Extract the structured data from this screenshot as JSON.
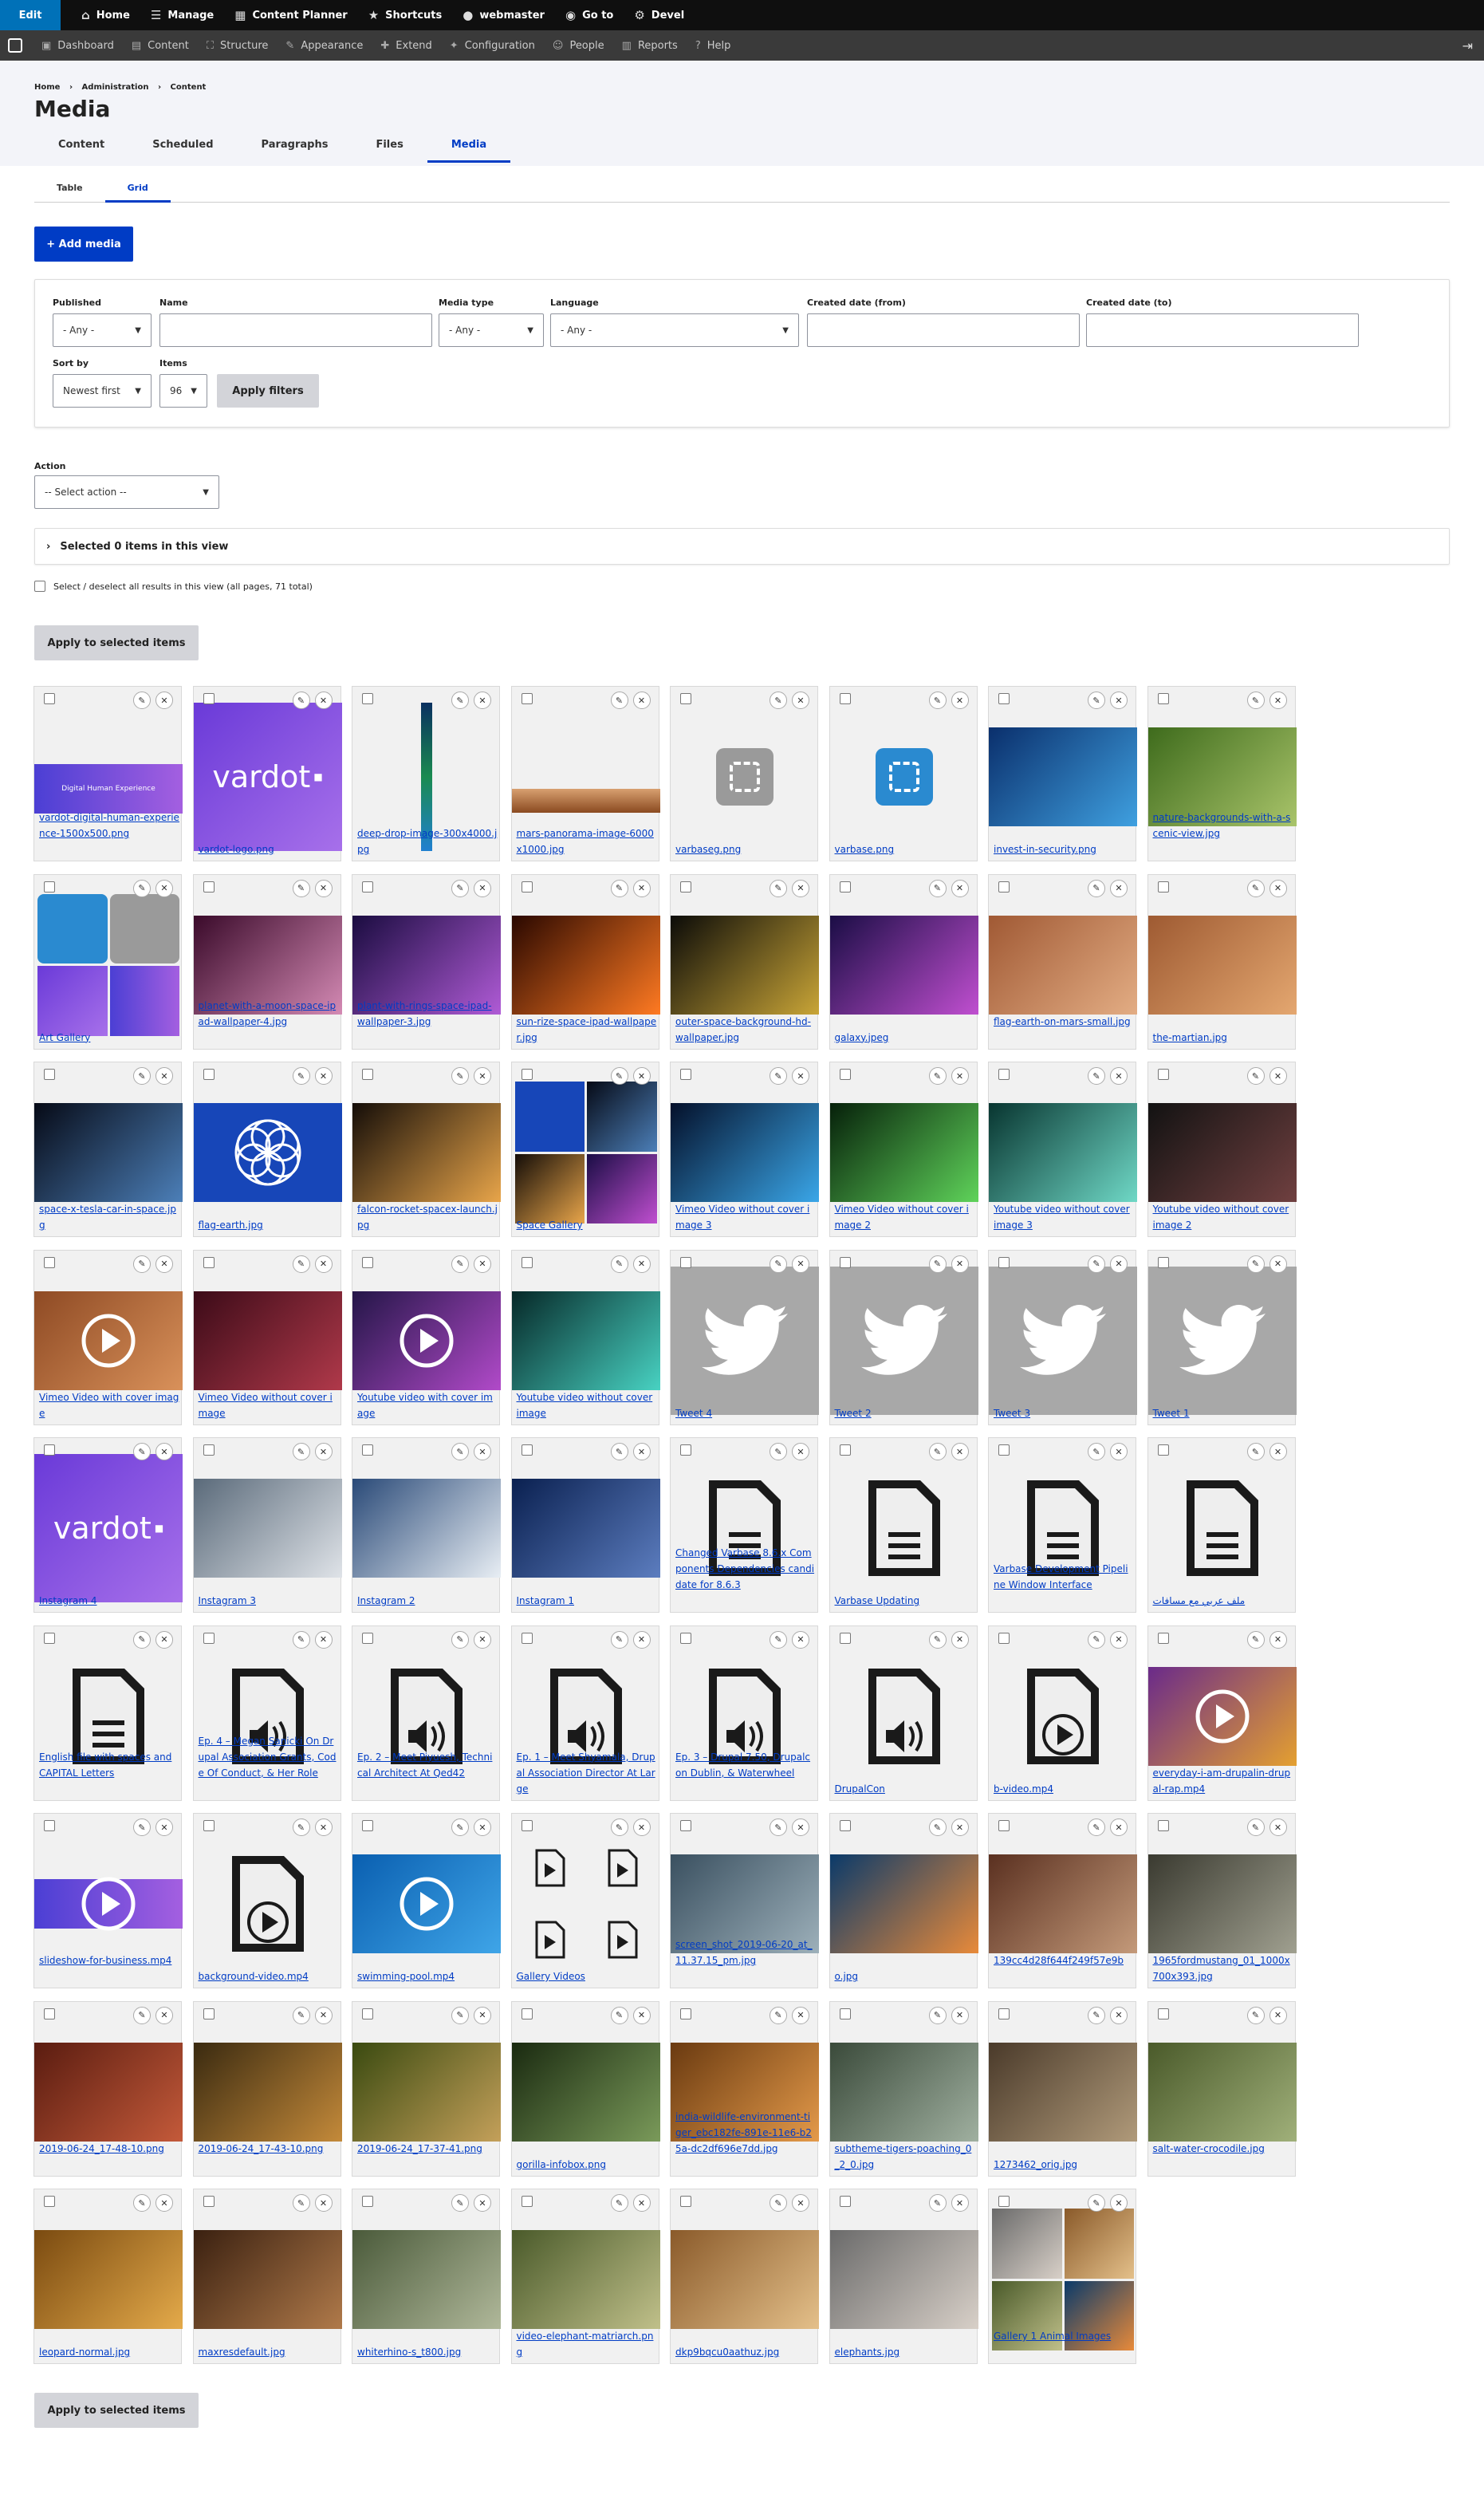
{
  "toolbar": {
    "edit": "Edit",
    "items": [
      {
        "icon": "home-icon",
        "label": "Home"
      },
      {
        "icon": "menu-icon",
        "label": "Manage"
      },
      {
        "icon": "calendar-icon",
        "label": "Content Planner"
      },
      {
        "icon": "star-icon",
        "label": "Shortcuts"
      },
      {
        "icon": "user-icon",
        "label": "webmaster"
      },
      {
        "icon": "goto-icon",
        "label": "Go to"
      },
      {
        "icon": "gear-icon",
        "label": "Devel"
      }
    ]
  },
  "adminmenu": [
    {
      "icon": "dashboard-icon",
      "label": "Dashboard"
    },
    {
      "icon": "content-icon",
      "label": "Content"
    },
    {
      "icon": "structure-icon",
      "label": "Structure"
    },
    {
      "icon": "appearance-icon",
      "label": "Appearance"
    },
    {
      "icon": "extend-icon",
      "label": "Extend"
    },
    {
      "icon": "wrench-icon",
      "label": "Configuration"
    },
    {
      "icon": "people-icon",
      "label": "People"
    },
    {
      "icon": "reports-icon",
      "label": "Reports"
    },
    {
      "icon": "help-icon",
      "label": "Help"
    }
  ],
  "breadcrumb": [
    "Home",
    "Administration",
    "Content"
  ],
  "title": "Media",
  "primary_tabs": [
    "Content",
    "Scheduled",
    "Paragraphs",
    "Files",
    "Media"
  ],
  "secondary_tabs": [
    "Table",
    "Grid"
  ],
  "add_media": "+ Add media",
  "filters": {
    "published_label": "Published",
    "published_value": "- Any -",
    "name_label": "Name",
    "name_value": "",
    "type_label": "Media type",
    "type_value": "- Any -",
    "lang_label": "Language",
    "lang_value": "- Any -",
    "from_label": "Created date (from)",
    "to_label": "Created date (to)",
    "sort_label": "Sort by",
    "sort_value": "Newest first",
    "items_label": "Items",
    "items_value": "96",
    "apply": "Apply filters"
  },
  "action_label": "Action",
  "action_value": "-- Select action --",
  "selected_text": "Selected 0 items in this view",
  "select_all": "Select / deselect all results in this view (all pages, 71 total)",
  "apply_selected": "Apply to selected items",
  "items": [
    {
      "cap": "vardot-digital-human-experience-1500x500.png",
      "kind": "banner"
    },
    {
      "cap": "vardot-logo.png",
      "kind": "vardot"
    },
    {
      "cap": "deep-drop-image-300x4000.jpg",
      "kind": "strip"
    },
    {
      "cap": "mars-panorama-image-6000x1000.jpg",
      "kind": "pano"
    },
    {
      "cap": "varbaseg.png",
      "kind": "grey-logo"
    },
    {
      "cap": "varbase.png",
      "kind": "blue-logo"
    },
    {
      "cap": "invest-in-security.png",
      "kind": "photo",
      "c1": "#0a2f6c",
      "c2": "#3fa0e0"
    },
    {
      "cap": "nature-backgrounds-with-a-scenic-view.jpg",
      "kind": "photo",
      "c1": "#3e6b1c",
      "c2": "#a9c46a"
    },
    {
      "cap": "Art Gallery",
      "kind": "gallery-art"
    },
    {
      "cap": "planet-with-a-moon-space-ipad-wallpaper-4.jpg",
      "kind": "photo",
      "c1": "#3a0a2a",
      "c2": "#d48ab4"
    },
    {
      "cap": "plant-with-rings-space-ipad-wallpaper-3.jpg",
      "kind": "photo",
      "c1": "#1a0c40",
      "c2": "#b05bd6"
    },
    {
      "cap": "sun-rize-space-ipad-wallpaper.jpg",
      "kind": "photo",
      "c1": "#2a0800",
      "c2": "#ff7a22"
    },
    {
      "cap": "outer-space-background-hd-wallpaper.jpg",
      "kind": "photo",
      "c1": "#0b0b08",
      "c2": "#c9a537"
    },
    {
      "cap": "galaxy.jpeg",
      "kind": "photo",
      "c1": "#1a0d45",
      "c2": "#c04fd0"
    },
    {
      "cap": "flag-earth-on-mars-small.jpg",
      "kind": "photo",
      "c1": "#a05934",
      "c2": "#e3ad84"
    },
    {
      "cap": "the-martian.jpg",
      "kind": "photo",
      "c1": "#9e5a32",
      "c2": "#e4a770"
    },
    {
      "cap": "space-x-tesla-car-in-space.jpg",
      "kind": "photo",
      "c1": "#060a16",
      "c2": "#4c7fb8"
    },
    {
      "cap": "flag-earth.jpg",
      "kind": "flag"
    },
    {
      "cap": "falcon-rocket-spacex-launch.jpg",
      "kind": "photo",
      "c1": "#140d08",
      "c2": "#e8a54a"
    },
    {
      "cap": "Space Gallery",
      "kind": "gallery-space"
    },
    {
      "cap": "Vimeo Video without cover image 3",
      "kind": "photo",
      "c1": "#04102a",
      "c2": "#3aa6e8"
    },
    {
      "cap": "Vimeo Video without cover image 2",
      "kind": "photo",
      "c1": "#06200a",
      "c2": "#5fd35a"
    },
    {
      "cap": "Youtube video without cover image 3",
      "kind": "photo",
      "c1": "#083530",
      "c2": "#6fd8c6"
    },
    {
      "cap": "Youtube video without cover image 2",
      "kind": "photo",
      "c1": "#121212",
      "c2": "#704040"
    },
    {
      "cap": "Vimeo Video with cover image",
      "kind": "play",
      "c1": "#8e4a24",
      "c2": "#d9915a"
    },
    {
      "cap": "Vimeo Video without cover image",
      "kind": "photo",
      "c1": "#3c0b18",
      "c2": "#b0394a"
    },
    {
      "cap": "Youtube video with cover image",
      "kind": "play",
      "c1": "#241648",
      "c2": "#b14ac9"
    },
    {
      "cap": "Youtube video without cover image",
      "kind": "photo",
      "c1": "#062828",
      "c2": "#48d2c2"
    },
    {
      "cap": "Tweet 4",
      "kind": "twitter"
    },
    {
      "cap": "Tweet 2",
      "kind": "twitter"
    },
    {
      "cap": "Tweet 3",
      "kind": "twitter"
    },
    {
      "cap": "Tweet 1",
      "kind": "twitter"
    },
    {
      "cap": "Instagram 4",
      "kind": "vardot"
    },
    {
      "cap": "Instagram 3",
      "kind": "photo",
      "c1": "#5a6a7a",
      "c2": "#dfe3e8"
    },
    {
      "cap": "Instagram 2",
      "kind": "photo",
      "c1": "#2a4a78",
      "c2": "#e8eef4"
    },
    {
      "cap": "Instagram 1",
      "kind": "photo",
      "c1": "#0a2050",
      "c2": "#5c7dbf"
    },
    {
      "cap": "Changed Varbase 8.6.x Components Dependencies candidate for 8.6.3",
      "kind": "doc"
    },
    {
      "cap": "Varbase Updating",
      "kind": "doc"
    },
    {
      "cap": "Varbase Development Pipeline Window Interface",
      "kind": "doc"
    },
    {
      "cap": "ملف عربي مع مسافات",
      "kind": "doc"
    },
    {
      "cap": "English file with spaces and CAPITAL Letters",
      "kind": "doc"
    },
    {
      "cap": "Ep. 4 – Megan Sanicki On Drupal Association Grants, Code Of Conduct, & Her Role",
      "kind": "audio"
    },
    {
      "cap": "Ep. 2 – Meet Piyuesh, Technical Architect At Qed42",
      "kind": "audio"
    },
    {
      "cap": "Ep. 1 – Meet Shyamala, Drupal Association Director At Large",
      "kind": "audio"
    },
    {
      "cap": "Ep. 3 – Drupal 7.50, Drupalcon Dublin, & Waterwheel",
      "kind": "audio"
    },
    {
      "cap": "DrupalCon",
      "kind": "audio"
    },
    {
      "cap": "b-video.mp4",
      "kind": "videofile"
    },
    {
      "cap": "everyday-i-am-drupalin-drupal-rap.mp4",
      "kind": "play",
      "c1": "#6a2a8a",
      "c2": "#e4a030"
    },
    {
      "cap": "slideshow-for-business.mp4",
      "kind": "playbanner"
    },
    {
      "cap": "background-video.mp4",
      "kind": "videofile"
    },
    {
      "cap": "swimming-pool.mp4",
      "kind": "play",
      "c1": "#0a5fb0",
      "c2": "#3fa5e8"
    },
    {
      "cap": "Gallery Videos",
      "kind": "gallery-video"
    },
    {
      "cap": "screen_shot_2019-06-20_at_11.37.15_pm.jpg",
      "kind": "photo",
      "c1": "#3a5060",
      "c2": "#9db0ba"
    },
    {
      "cap": "o.jpg",
      "kind": "photo",
      "c1": "#0a3a6a",
      "c2": "#e88a3a"
    },
    {
      "cap": "139cc4d28f644f249f57e9b",
      "kind": "photo",
      "c1": "#5a3020",
      "c2": "#c49a7a"
    },
    {
      "cap": "1965fordmustang_01_1000x700x393.jpg",
      "kind": "photo",
      "c1": "#3a3a30",
      "c2": "#a0a090"
    },
    {
      "cap": "2019-06-24_17-48-10.png",
      "kind": "photo",
      "c1": "#5a1c10",
      "c2": "#c45a3a"
    },
    {
      "cap": "2019-06-24_17-43-10.png",
      "kind": "photo",
      "c1": "#3a2a10",
      "c2": "#c48a3a"
    },
    {
      "cap": "2019-06-24_17-37-41.png",
      "kind": "photo",
      "c1": "#3a4a10",
      "c2": "#c4a05a"
    },
    {
      "cap": "gorilla-infobox.png",
      "kind": "photo",
      "c1": "#1a2a10",
      "c2": "#7a9a5a"
    },
    {
      "cap": "india-wildlife-environment-tiger_ebc182fe-891e-11e6-b25a-dc2df696e7dd.jpg",
      "kind": "photo",
      "c1": "#6a3a10",
      "c2": "#e49a4a"
    },
    {
      "cap": "subtheme-tigers-poaching_0_2_0.jpg",
      "kind": "photo",
      "c1": "#3a4a3a",
      "c2": "#a0b0a0"
    },
    {
      "cap": "1273462_orig.jpg",
      "kind": "photo",
      "c1": "#4a3a2a",
      "c2": "#b09a7a"
    },
    {
      "cap": "salt-water-crocodile.jpg",
      "kind": "photo",
      "c1": "#4a5a2a",
      "c2": "#a0b07a"
    },
    {
      "cap": "leopard-normal.jpg",
      "kind": "photo",
      "c1": "#7a4a10",
      "c2": "#e4aa4a"
    },
    {
      "cap": "maxresdefault.jpg",
      "kind": "photo",
      "c1": "#3a2010",
      "c2": "#b07a4a"
    },
    {
      "cap": "whiterhino-s_t800.jpg",
      "kind": "photo",
      "c1": "#4a5a3a",
      "c2": "#b0b89a"
    },
    {
      "cap": "video-elephant-matriarch.png",
      "kind": "photo",
      "c1": "#4a5a2a",
      "c2": "#c0c08a"
    },
    {
      "cap": "dkp9bqcu0aathuz.jpg",
      "kind": "photo",
      "c1": "#8a5a2a",
      "c2": "#e4c08a"
    },
    {
      "cap": "elephants.jpg",
      "kind": "photo",
      "c1": "#6a6a6a",
      "c2": "#d8d0c8"
    },
    {
      "cap": "Gallery 1 Animal Images",
      "kind": "gallery-animal"
    }
  ]
}
